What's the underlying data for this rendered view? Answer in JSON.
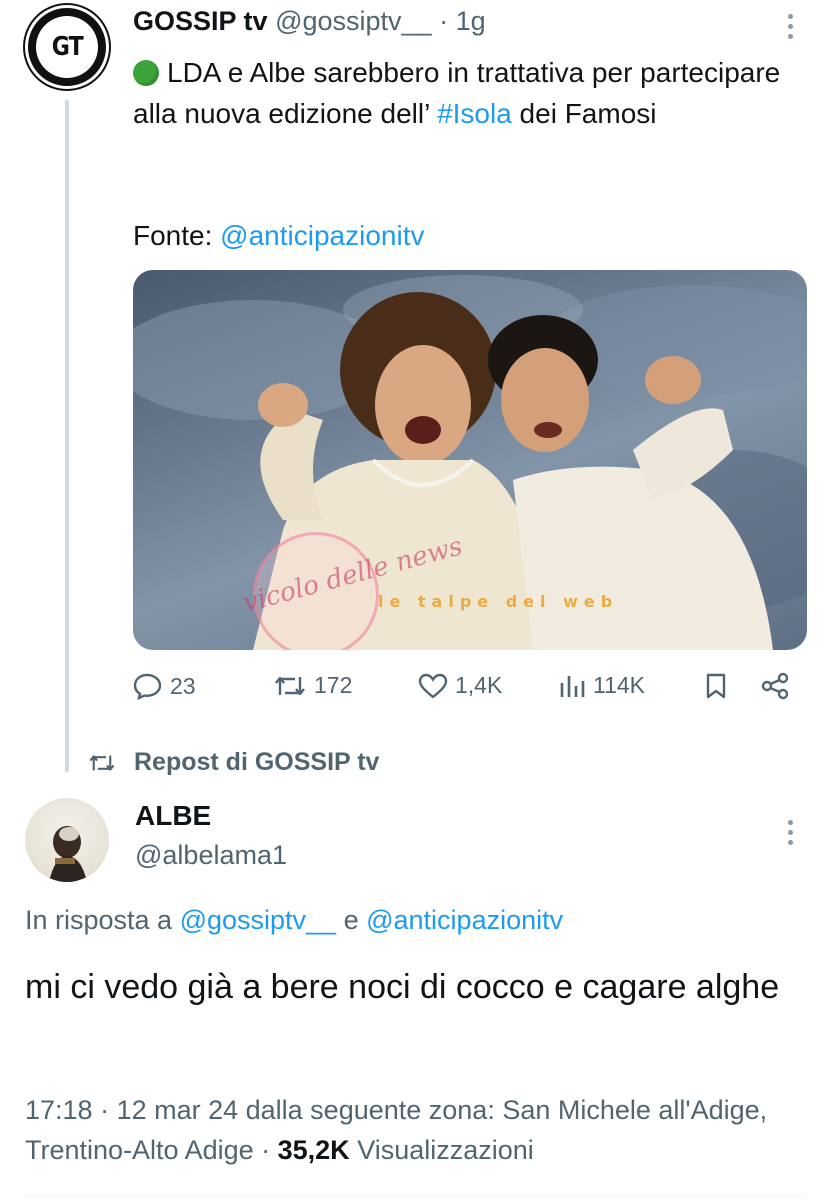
{
  "original_tweet": {
    "author_name": "GOSSIP tv",
    "author_handle": "@gossiptv__",
    "time": "· 1g",
    "avatar_text": "GT",
    "text_part1": "LDA e Albe sarebbero in trattativa per partecipare alla nuova edizione dell’ ",
    "hashtag": "#Isola",
    "text_part2": " dei Famosi",
    "source_label": "Fonte: ",
    "source_mention": "@anticipazionitv",
    "status_icon": "green-circle-icon",
    "photo_description_icon": "photo",
    "actions": {
      "replies": "23",
      "reposts": "172",
      "likes": "1,4K",
      "views": "114K"
    },
    "watermark_left": "vicolo delle news",
    "watermark_right": "le talpe del web"
  },
  "repost_banner": {
    "label": "Repost di GOSSIP tv"
  },
  "reply_tweet": {
    "author_name": "ALBE",
    "author_handle": "@albelama1",
    "reply_to_label": "In risposta a ",
    "reply_to_user1": "@gossiptv__",
    "reply_to_and": " e ",
    "reply_to_user2": "@anticipazionitv",
    "text": "mi ci vedo già a bere noci di cocco e cagare alghe",
    "meta_prefix": "17:18 · 12 mar 24 dalla seguente zona: San Michele all'Adige, Trentino-Alto Adige · ",
    "views_count": "35,2K",
    "views_label": " Visualizzazioni"
  },
  "colors": {
    "link": "#1d9bf0",
    "secondary_text": "#536471",
    "primary_text": "#0f1419",
    "thread_line": "#cfd9de"
  }
}
